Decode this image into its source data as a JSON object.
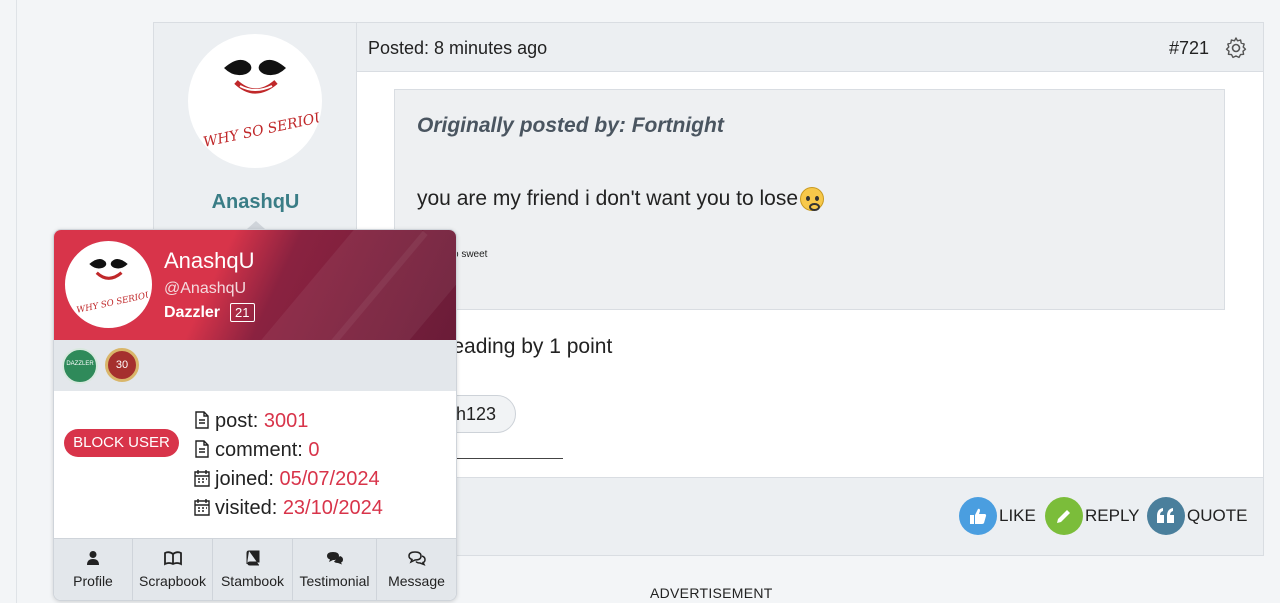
{
  "post": {
    "author": "AnashqU",
    "posted_label": "Posted: 8 minutes ago",
    "post_number": "#721",
    "quote": {
      "title": "Originally posted by: Fortnight",
      "text": "you are my friend i don't want you to lose",
      "small_text": "o sweet"
    },
    "body_text": "t leading by 1 point",
    "tag": "th123",
    "actions": {
      "like": "LIKE",
      "reply": "REPLY",
      "quote": "QUOTE"
    }
  },
  "advertisement": "ADVERTISEMENT",
  "profile_card": {
    "name": "AnashqU",
    "handle": "@AnashqU",
    "rank": "Dazzler",
    "level": "21",
    "badges": [
      {
        "name": "dazzler-badge",
        "label": "DAZZLER"
      },
      {
        "name": "30-badge",
        "label": "30"
      }
    ],
    "block_label": "BLOCK USER",
    "stats": {
      "post_label": "post:",
      "post_value": "3001",
      "comment_label": "comment:",
      "comment_value": "0",
      "joined_label": "joined:",
      "joined_value": "05/07/2024",
      "visited_label": "visited:",
      "visited_value": "23/10/2024"
    },
    "tabs": [
      "Profile",
      "Scrapbook",
      "Stambook",
      "Testimonial",
      "Message"
    ]
  },
  "avatar_text": "WHY SO SERIOUS?",
  "colors": {
    "accent": "#d8344a",
    "username": "#3a7d86",
    "like": "#4a9ee0",
    "reply": "#7bbd3a",
    "quote": "#4a7f9c"
  }
}
